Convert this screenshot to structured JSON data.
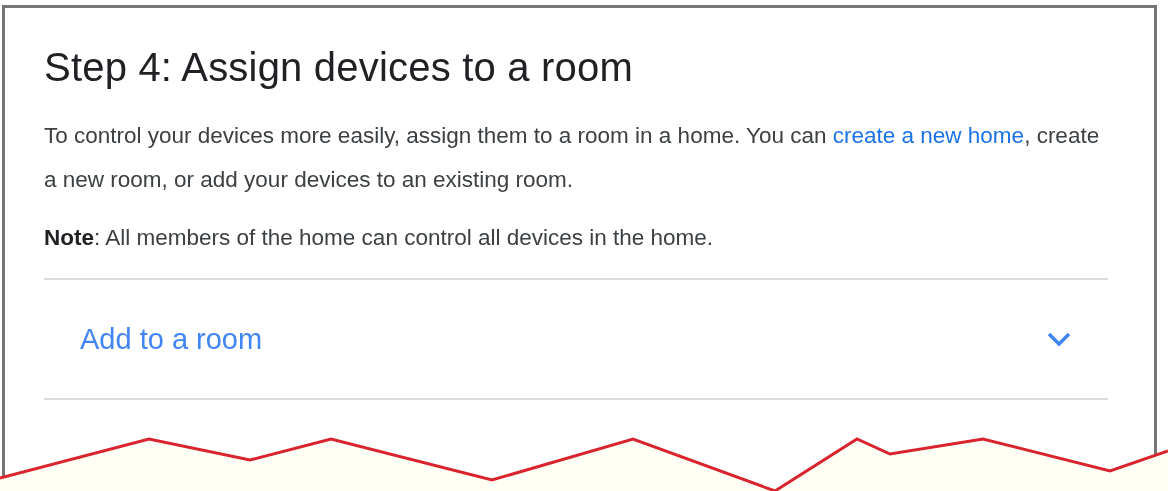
{
  "title": "Step 4: Assign devices to a room",
  "intro": {
    "text_before": "To control your devices more easily, assign them to a room in a home. You can ",
    "link": "create a new home",
    "text_after": ", create a new room, or add your devices to an existing room."
  },
  "note": "**Note**: All members of the home can control all devices in the home.",
  "expander": {
    "label": "Add to a room",
    "expanded": false
  }
}
